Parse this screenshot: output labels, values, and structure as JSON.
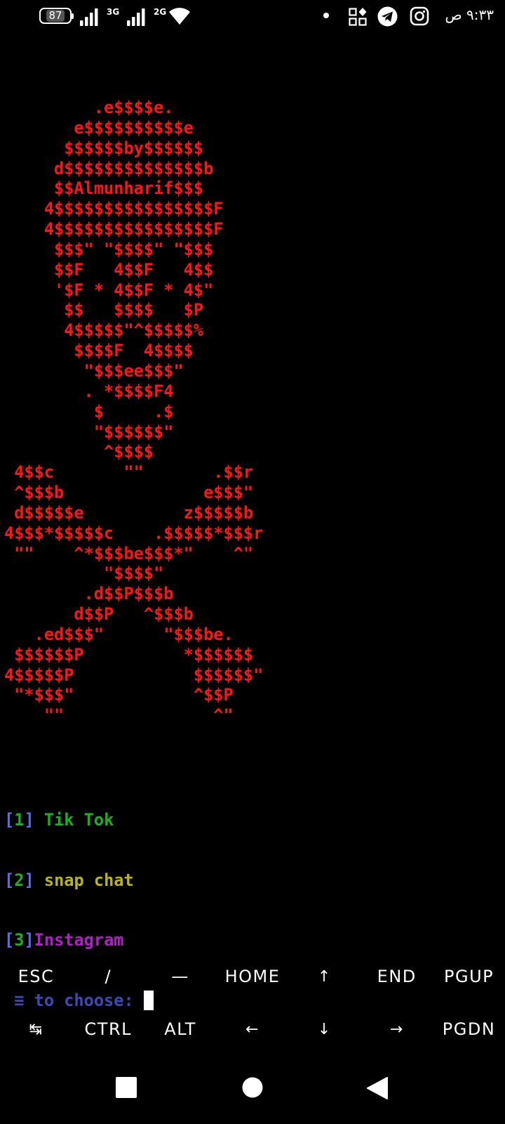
{
  "status_bar": {
    "battery": "87",
    "network1": "3G",
    "network2": "2G",
    "time": "٩:٣٣ ص"
  },
  "terminal": {
    "ascii_art": [
      "         .e$$$$e.",
      "       e$$$$$$$$$$e",
      "      $$$$$$by$$$$$$",
      "     d$$$$$$$$$$$$$$b",
      "     $$Almunharif$$$",
      "    4$$$$$$$$$$$$$$$$F",
      "    4$$$$$$$$$$$$$$$$F",
      "     $$$\" \"$$$$\" \"$$$",
      "     $$F   4$$F   4$$",
      "     '$F * 4$$F * 4$\"",
      "      $$   $$$$   $P",
      "      4$$$$$\"^$$$$$%",
      "       $$$$F  4$$$$",
      "        \"$$$ee$$$\"",
      "        . *$$$$F4",
      "         $     .$",
      "         \"$$$$$$\"",
      "          ^$$$$",
      " 4$$c       \"\"       .$$r",
      " ^$$$b              e$$$\"",
      " d$$$$$e          z$$$$$b",
      "4$$$*$$$$$c    .$$$$$*$$$r",
      " \"\"    ^*$$$be$$$*\"    ^\"",
      "          \"$$$$\"",
      "        .d$$P$$$b",
      "       d$$P   ^$$$b",
      "   .ed$$$\"      \"$$$be.",
      " $$$$$$P          *$$$$$$",
      "4$$$$$P            $$$$$$\"",
      " \"*$$$\"            ^$$P",
      "    \"\"               ^\""
    ],
    "menu": [
      {
        "bracket_open": "[",
        "number": "1",
        "bracket_close": "]",
        "label": " Tik Tok"
      },
      {
        "bracket_open": "[",
        "number": "2",
        "bracket_close": "]",
        "label": " snap chat"
      },
      {
        "bracket_open": "[",
        "number": "3",
        "bracket_close": "]",
        "label": "Instagram"
      }
    ],
    "prompt": " ≡ to choose: "
  },
  "extra_keys": {
    "row1": [
      "ESC",
      "/",
      "—",
      "HOME",
      "↑",
      "END",
      "PGUP"
    ],
    "row2": [
      "↹",
      "CTRL",
      "ALT",
      "←",
      "↓",
      "→",
      "PGDN"
    ]
  },
  "colors": {
    "ascii_red": "#ff1515",
    "bracket_blue": "#5b6ee8",
    "num_green": "#19b419",
    "tiktok_green": "#19b419",
    "snapchat_yellow": "#b9b417",
    "instagram_magenta": "#b21fc8",
    "prompt_blue": "#3c4ab6"
  },
  "nav_icons": [
    "recent-apps-icon",
    "home-icon",
    "back-icon"
  ]
}
